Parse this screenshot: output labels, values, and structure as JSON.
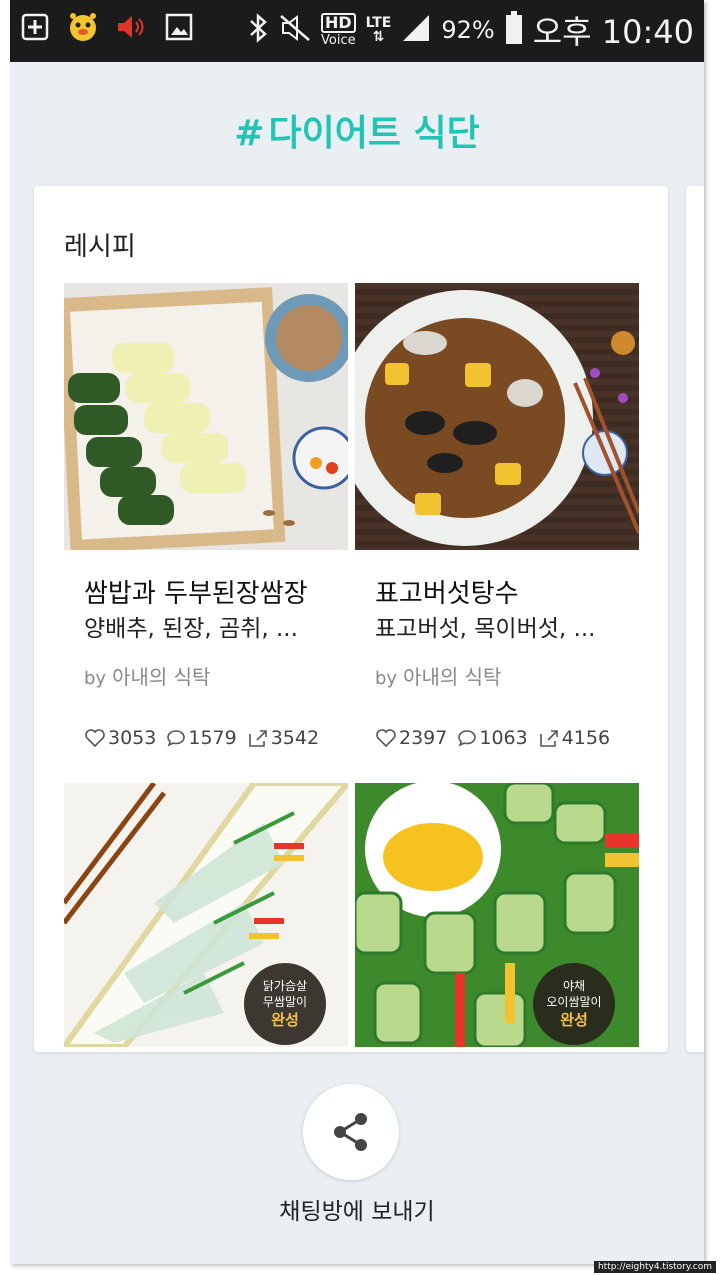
{
  "statusbar": {
    "battery_percent": "92%",
    "ampm": "오후",
    "time": "10:40",
    "hd_label": "HD",
    "voice_label": "Voice",
    "lte_label": "LTE",
    "icons": [
      "add-icon",
      "alarm-app-icon",
      "volume-icon",
      "gallery-icon",
      "bluetooth-icon",
      "mute-icon",
      "signal-icon",
      "battery-icon"
    ]
  },
  "header": {
    "hash": "#",
    "title": "다이어트 식단"
  },
  "card": {
    "heading": "레시피",
    "recipes": [
      {
        "title": "쌈밥과 두부된장쌈장",
        "ingredients": "양배추, 된장, 곰취, ...",
        "by": "by",
        "author": "아내의 식탁",
        "likes": "3053",
        "comments": "1579",
        "shares": "3542"
      },
      {
        "title": "표고버섯탕수",
        "ingredients": "표고버섯, 목이버섯, ...",
        "by": "by",
        "author": "아내의 식탁",
        "likes": "2397",
        "comments": "1063",
        "shares": "4156"
      }
    ],
    "lower_tiles": [
      {
        "badge_line1": "닭가슴살",
        "badge_line2": "무쌈말이",
        "badge_done": "완성"
      },
      {
        "badge_line1": "야채",
        "badge_line2": "오이쌈말이",
        "badge_done": "완성"
      }
    ]
  },
  "share": {
    "label": "채팅방에 보내기"
  },
  "watermark": "http://eighty4.tistory.com",
  "colors": {
    "accent": "#22c4b5",
    "background": "#e9eff3",
    "badge_done": "#f3c24a"
  }
}
